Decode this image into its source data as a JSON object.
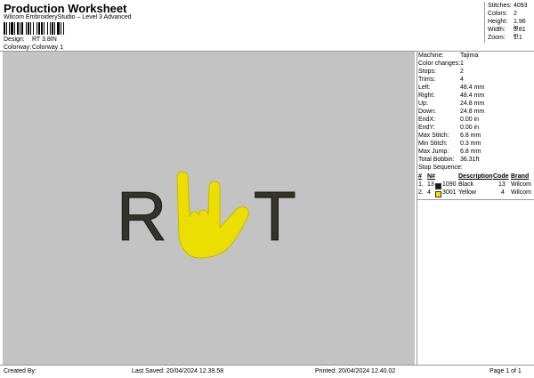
{
  "header": {
    "title": "Production Worksheet",
    "subtitle": "Wilcom EmbroideryStudio – Level 3 Advanced",
    "design_label": "Design:",
    "design_value": "RT 3.8IN",
    "colorway_label": "Colorway:",
    "colorway_value": "Colorway 1"
  },
  "summary": [
    {
      "label": "Stitches:",
      "value": "4093"
    },
    {
      "label": "Colors:",
      "value": "2"
    },
    {
      "label": "Height:",
      "value": "1.96 in"
    },
    {
      "label": "Width:",
      "value": "3.81 in"
    },
    {
      "label": "Zoom:",
      "value": "1:1"
    }
  ],
  "design_preview": {
    "letter_left": "R",
    "letter_right": "T",
    "letter_color": "#3a3a32",
    "hand_color": "#f2e600",
    "background": "#c3c3c3"
  },
  "machine_info": [
    {
      "label": "Machine:",
      "value": "Tajima"
    },
    {
      "label": "Color changes:",
      "value": "1"
    },
    {
      "label": "Stops:",
      "value": "2"
    },
    {
      "label": "Trims:",
      "value": "4"
    },
    {
      "label": "Left:",
      "value": "48.4 mm"
    },
    {
      "label": "Right:",
      "value": "48.4 mm"
    },
    {
      "label": "Up:",
      "value": "24.8 mm"
    },
    {
      "label": "Down:",
      "value": "24.8 mm"
    },
    {
      "label": "EndX:",
      "value": "0.00 in"
    },
    {
      "label": "EndY:",
      "value": "0.00 in"
    },
    {
      "label": "Max Stitch:",
      "value": "6.8 mm"
    },
    {
      "label": "Min Stitch:",
      "value": "0.3 mm"
    },
    {
      "label": "Max Jump:",
      "value": "6.8 mm"
    },
    {
      "label": "Total Bobbin:",
      "value": "36.31ft"
    }
  ],
  "stop_sequence": {
    "title": "Stop Sequence:",
    "columns": [
      "#",
      "N#",
      "Description",
      "Code",
      "Brand"
    ],
    "rows": [
      {
        "num": "1.",
        "n": "13",
        "swatch": "#1a1a1a",
        "color_code": "1090",
        "description": "Black",
        "code": "13",
        "brand": "Wilcom"
      },
      {
        "num": "2.",
        "n": "4",
        "swatch": "#f2e600",
        "color_code": "3001",
        "description": "Yellow",
        "code": "4",
        "brand": "Wilcom"
      }
    ]
  },
  "footer": {
    "created_by": "Created By:",
    "last_saved": "Last Saved: 20/04/2024 12.39.58",
    "printed": "Printed: 20/04/2024 12.40.02",
    "page": "Page 1 of 1"
  }
}
